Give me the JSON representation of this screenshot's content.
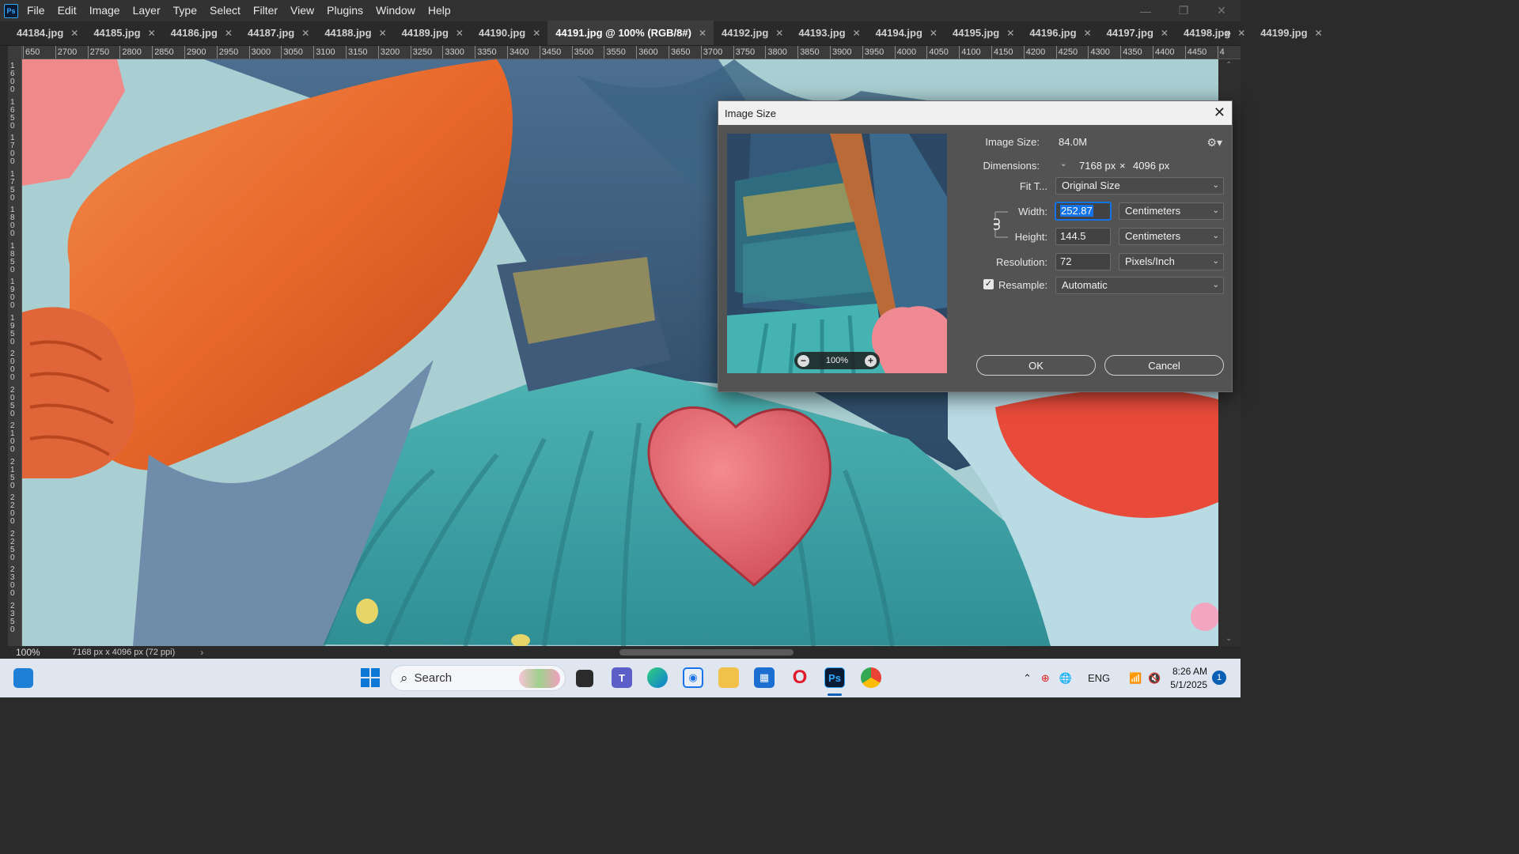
{
  "menubar": {
    "app_icon": "Ps",
    "items": [
      "File",
      "Edit",
      "Image",
      "Layer",
      "Type",
      "Select",
      "Filter",
      "View",
      "Plugins",
      "Window",
      "Help"
    ]
  },
  "tabs": [
    {
      "label": "44184.jpg",
      "active": false
    },
    {
      "label": "44185.jpg",
      "active": false
    },
    {
      "label": "44186.jpg",
      "active": false
    },
    {
      "label": "44187.jpg",
      "active": false
    },
    {
      "label": "44188.jpg",
      "active": false
    },
    {
      "label": "44189.jpg",
      "active": false
    },
    {
      "label": "44190.jpg",
      "active": false
    },
    {
      "label": "44191.jpg @ 100% (RGB/8#)",
      "active": true
    },
    {
      "label": "44192.jpg",
      "active": false
    },
    {
      "label": "44193.jpg",
      "active": false
    },
    {
      "label": "44194.jpg",
      "active": false
    },
    {
      "label": "44195.jpg",
      "active": false
    },
    {
      "label": "44196.jpg",
      "active": false
    },
    {
      "label": "44197.jpg",
      "active": false
    },
    {
      "label": "44198.jpg",
      "active": false
    },
    {
      "label": "44199.jpg",
      "active": false
    }
  ],
  "tab_overflow": "»",
  "ruler_top": [
    "650",
    "2700",
    "2750",
    "2800",
    "2850",
    "2900",
    "2950",
    "3000",
    "3050",
    "3100",
    "3150",
    "3200",
    "3250",
    "3300",
    "3350",
    "3400",
    "3450",
    "3500",
    "3550",
    "3600",
    "3650",
    "3700",
    "3750",
    "3800",
    "3850",
    "3900",
    "3950",
    "4000",
    "4050",
    "4100",
    "4150",
    "4200",
    "4250",
    "4300",
    "4350",
    "4400",
    "4450",
    "4"
  ],
  "ruler_left": [
    "1600",
    "1650",
    "1700",
    "1750",
    "1800",
    "1850",
    "1900",
    "1950",
    "2000",
    "2050",
    "2100",
    "2150",
    "2200",
    "2250",
    "2300",
    "2350"
  ],
  "status": {
    "zoom": "100%",
    "doc_info": "7168 px x 4096 px (72 ppi)",
    "arrow": "›"
  },
  "dialog": {
    "title": "Image Size",
    "preview_zoom": "100%",
    "image_size_label": "Image Size:",
    "image_size_value": "84.0M",
    "dimensions_label": "Dimensions:",
    "dimensions_width": "7168 px",
    "dimensions_times": "×",
    "dimensions_height": "4096 px",
    "fit_to_label": "Fit T...",
    "fit_to_value": "Original Size",
    "width_label": "Width:",
    "width_value": "252.87",
    "width_unit": "Centimeters",
    "height_label": "Height:",
    "height_value": "144.5",
    "height_unit": "Centimeters",
    "resolution_label": "Resolution:",
    "resolution_value": "72",
    "resolution_unit": "Pixels/Inch",
    "resample_label": "Resample:",
    "resample_value": "Automatic",
    "ok_label": "OK",
    "cancel_label": "Cancel"
  },
  "taskbar": {
    "search_placeholder": "Search",
    "language": "ENG",
    "time": "8:26 AM",
    "date": "5/1/2025",
    "notification_count": "1",
    "icons": [
      "windows-start-icon",
      "search-icon",
      "task-view-icon",
      "teams-icon",
      "edge-icon",
      "camera-icon",
      "file-explorer-icon",
      "store-icon",
      "opera-icon",
      "photoshop-icon",
      "chrome-icon"
    ]
  },
  "colors": {
    "accent": "#1473e6",
    "ps_blue": "#31a8ff",
    "dialog_bg": "#535353",
    "chrome_bg": "#323232"
  }
}
